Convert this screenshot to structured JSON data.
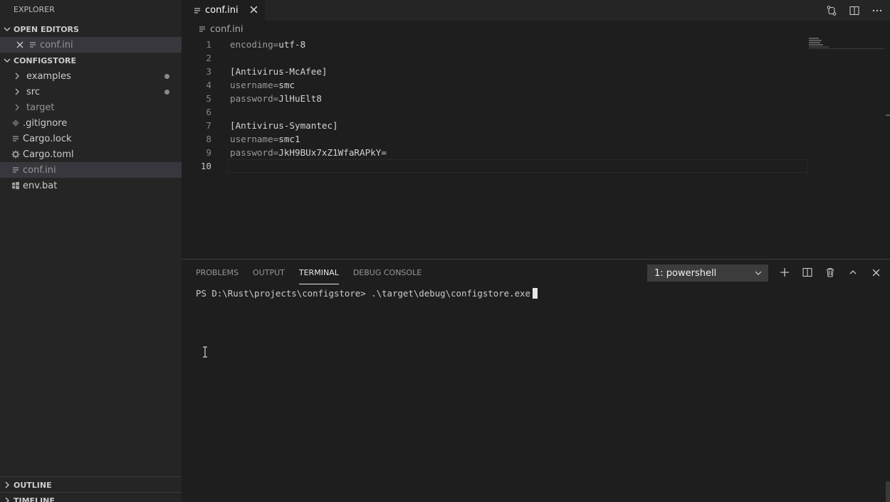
{
  "sidebar": {
    "title": "EXPLORER",
    "open_editors": {
      "header": "OPEN EDITORS",
      "items": [
        {
          "label": "conf.ini"
        }
      ]
    },
    "project": {
      "header": "CONFIGSTORE",
      "items": [
        {
          "label": "examples",
          "type": "folder",
          "modified": true
        },
        {
          "label": "src",
          "type": "folder",
          "modified": true
        },
        {
          "label": "target",
          "type": "folder",
          "dim": true
        },
        {
          "label": ".gitignore",
          "type": "git",
          "dim": false
        },
        {
          "label": "Cargo.lock",
          "type": "lines"
        },
        {
          "label": "Cargo.toml",
          "type": "gear"
        },
        {
          "label": "conf.ini",
          "type": "lines",
          "selected": true
        },
        {
          "label": "env.bat",
          "type": "windows"
        }
      ]
    },
    "outline": {
      "header": "OUTLINE"
    },
    "timeline": {
      "header": "TIMELINE"
    }
  },
  "editor": {
    "tab": {
      "label": "conf.ini"
    },
    "breadcrumb": "conf.ini",
    "lines": [
      {
        "n": "1",
        "key": "encoding",
        "val": "utf-8"
      },
      {
        "n": "2"
      },
      {
        "n": "3",
        "section": "[Antivirus-McAfee]"
      },
      {
        "n": "4",
        "key": "username",
        "val": "smc"
      },
      {
        "n": "5",
        "key": "password",
        "val": "JlHuElt8"
      },
      {
        "n": "6"
      },
      {
        "n": "7",
        "section": "[Antivirus-Symantec]"
      },
      {
        "n": "8",
        "key": "username",
        "val": "smc1"
      },
      {
        "n": "9",
        "key": "password",
        "val": "JkH9BUx7xZ1WfaRAPkY="
      },
      {
        "n": "10"
      }
    ]
  },
  "panel": {
    "tabs": [
      "PROBLEMS",
      "OUTPUT",
      "TERMINAL",
      "DEBUG CONSOLE"
    ],
    "active_tab": "TERMINAL",
    "terminal_select": "1: powershell",
    "prompt": "PS D:\\Rust\\projects\\configstore> .\\target\\debug\\configstore.exe"
  }
}
